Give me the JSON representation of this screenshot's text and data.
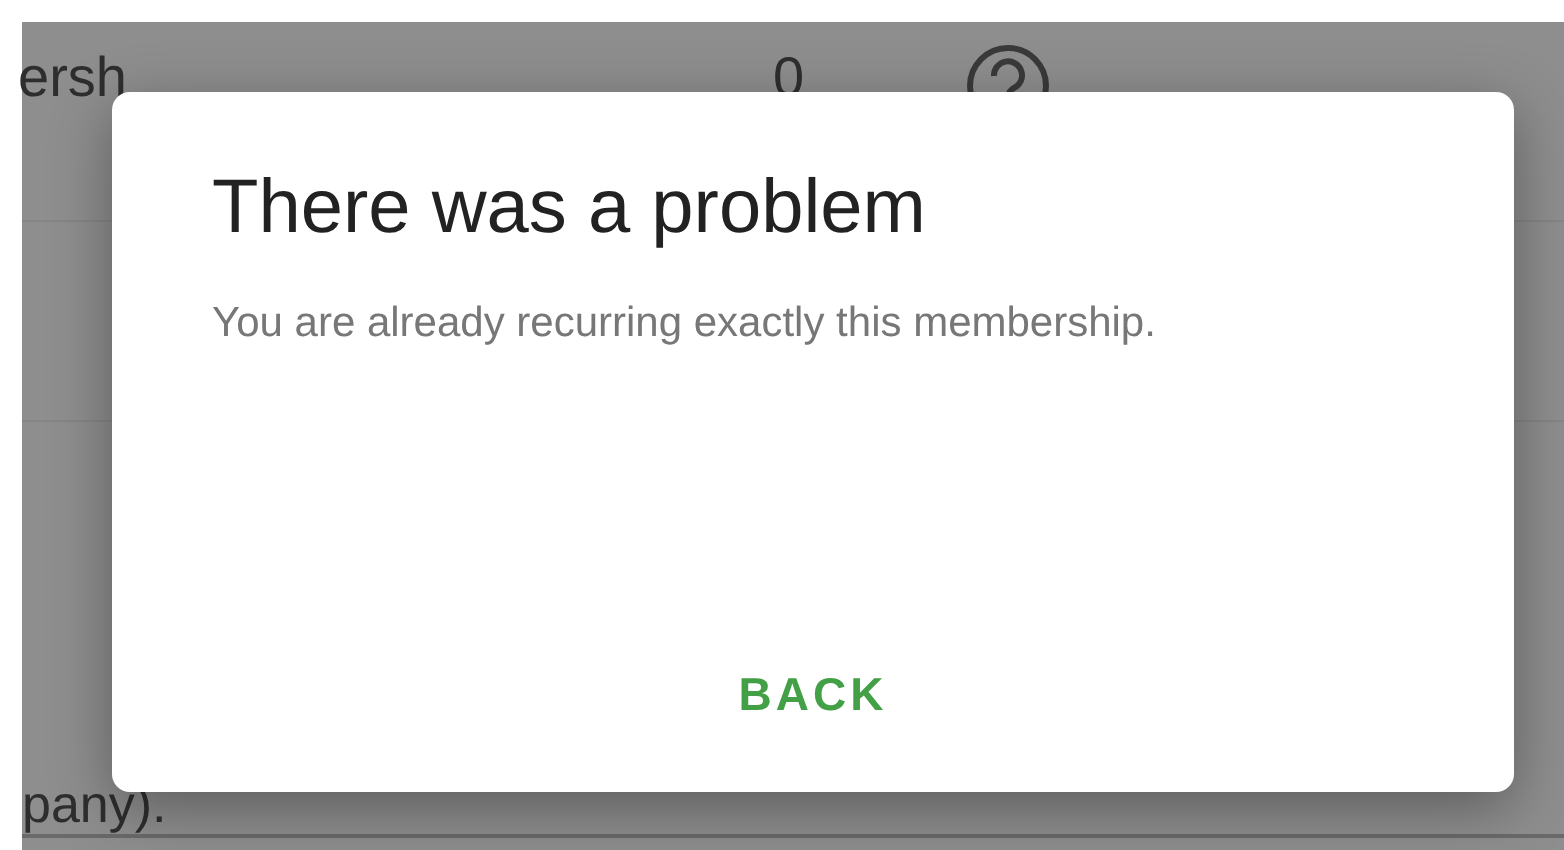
{
  "background": {
    "question_text": "ersh",
    "answer_value": "0",
    "footer_text": "pany)."
  },
  "dialog": {
    "title": "There was a problem",
    "message": "You are already recurring exactly this membership.",
    "buttons": [
      {
        "label": "BACK"
      }
    ]
  }
}
